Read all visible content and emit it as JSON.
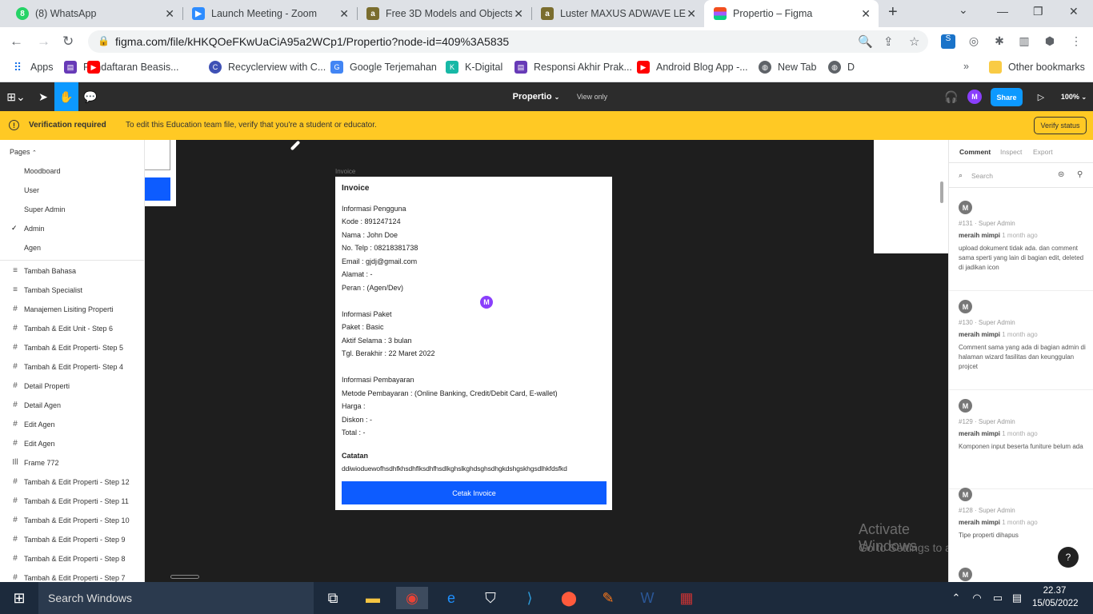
{
  "browser": {
    "tabs": [
      {
        "title": "(8) WhatsApp",
        "icon": "whatsapp-icon"
      },
      {
        "title": "Launch Meeting - Zoom",
        "icon": "zoom-icon"
      },
      {
        "title": "Free 3D Models and Objects",
        "icon": "archive3d-icon"
      },
      {
        "title": "Luster MAXUS ADWAVE LED",
        "icon": "archive3d-icon"
      },
      {
        "title": "Propertio – Figma",
        "icon": "figma-icon"
      }
    ],
    "url": "figma.com/file/kHKQOeFKwUaCiA95a2WCp1/Propertio?node-id=409%3A5835",
    "bookmarks": [
      "Apps",
      "Pendaftaran Beasis...",
      "Recyclerview with C...",
      "Google Terjemahan",
      "K-Digital",
      "Responsi Akhir Prak...",
      "Android Blog App -...",
      "New Tab",
      "D"
    ],
    "other_bookmarks": "Other bookmarks"
  },
  "figma": {
    "file_name": "Propertio",
    "view_mode": "View only",
    "avatar": "M",
    "share_label": "Share",
    "zoom": "100%",
    "banner": {
      "title": "Verification required",
      "message": "To edit this Education team file, verify that you're a student or educator.",
      "button": "Verify status"
    },
    "pages_label": "Pages",
    "pages": [
      "Moodboard",
      "User",
      "Super Admin",
      "Admin",
      "Agen"
    ],
    "layers": [
      {
        "icon": "≡",
        "name": "Tambah Bahasa"
      },
      {
        "icon": "≡",
        "name": "Tambah Specialist"
      },
      {
        "icon": "#",
        "name": "Manajemen Lisiting Properti"
      },
      {
        "icon": "#",
        "name": "Tambah & Edit Unit - Step 6"
      },
      {
        "icon": "#",
        "name": "Tambah & Edit Properti- Step 5"
      },
      {
        "icon": "#",
        "name": "Tambah & Edit Properti- Step 4"
      },
      {
        "icon": "#",
        "name": "Detail Properti"
      },
      {
        "icon": "#",
        "name": "Detail Agen"
      },
      {
        "icon": "#",
        "name": "Edit Agen"
      },
      {
        "icon": "#",
        "name": "Edit Agen"
      },
      {
        "icon": "Ill",
        "name": "Frame 772"
      },
      {
        "icon": "#",
        "name": "Tambah & Edit Properti - Step 12"
      },
      {
        "icon": "#",
        "name": "Tambah & Edit Properti - Step 11"
      },
      {
        "icon": "#",
        "name": "Tambah & Edit Properti - Step 10"
      },
      {
        "icon": "#",
        "name": "Tambah & Edit Properti - Step 9"
      },
      {
        "icon": "#",
        "name": "Tambah & Edit Properti - Step 8"
      },
      {
        "icon": "#",
        "name": "Tambah & Edit Properti - Step 7"
      }
    ],
    "frame_label": "Invoice",
    "cursor_avatar": "M",
    "invoice": {
      "title": "Invoice",
      "lines": [
        "Informasi Pengguna",
        "Kode : 891247124",
        "Nama : John Doe",
        "No. Telp : 08218381738",
        "Email : gjdj@gmail.com",
        "Alamat : -",
        "Peran : (Agen/Dev)",
        "Informasi Paket",
        "Paket : Basic",
        "Aktif Selama : 3 bulan",
        "Tgl. Berakhir : 22 Maret 2022",
        "Informasi Pembayaran",
        "Metode Pembayaran : (Online Banking, Credit/Debit Card, E-wallet)",
        "Harga :",
        "Diskon : -",
        "Total : -"
      ],
      "note_label": "Catatan",
      "note_text": "ddiwioduewofhsdhfkhsdhflksdhfhsdlkghslkghdsghsdhgkdshgskhgsdlhkfdsfkd",
      "button": "Cetak Invoice"
    },
    "right_tabs": [
      "Comment",
      "Inspect",
      "Export"
    ],
    "search_placeholder": "Search",
    "comments": [
      {
        "avatar": "M",
        "id_role": "#131 · Super Admin",
        "author": "meraih mimpi",
        "time": "1 month ago",
        "text": "upload dokument tidak ada. dan comment sama sperti yang lain di bagian edit, deleted di jadikan icon"
      },
      {
        "avatar": "M",
        "id_role": "#130 · Super Admin",
        "author": "meraih mimpi",
        "time": "1 month ago",
        "text": "Comment sama yang ada di bagian admin di halaman wizard fasilitas dan keunggulan projcet"
      },
      {
        "avatar": "M",
        "id_role": "#129 · Super Admin",
        "author": "meraih mimpi",
        "time": "1 month ago",
        "text": "Komponen input beserta funiture belum ada"
      },
      {
        "avatar": "M",
        "id_role": "#128 · Super Admin",
        "author": "meraih mimpi",
        "time": "1 month ago",
        "text": "Tipe properti dihapus"
      }
    ],
    "next_avatar": "M",
    "help": "?"
  },
  "watermark": {
    "title": "Activate Windows",
    "subtitle": "Go to Settings to activate Windows."
  },
  "taskbar": {
    "search": "Search Windows",
    "time": "22.37",
    "date": "15/05/2022"
  },
  "colors": {
    "figma_blue": "#0d5cff",
    "banner": "#ffc924",
    "avatar_purple": "#8a3ffc"
  }
}
